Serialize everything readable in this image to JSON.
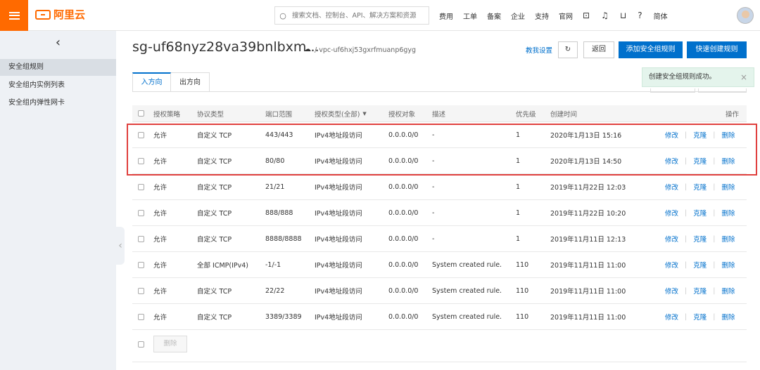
{
  "topbar": {
    "logo_text": "阿里云",
    "search_placeholder": "搜索文档、控制台、API、解决方案和资源",
    "nav": [
      "费用",
      "工单",
      "备案",
      "企业",
      "支持",
      "官网"
    ],
    "lang": "简体"
  },
  "sidebar": {
    "back_glyph": "‹",
    "items": [
      "安全组规则",
      "安全组内实例列表",
      "安全组内弹性网卡"
    ]
  },
  "header": {
    "title": "sg-uf68nyz28va39bnlbxm...",
    "vpc": "/ vpc-uf6hxj53gxrfmuanp6gyg",
    "teach": "教我设置",
    "back_btn": "返回",
    "add_btn": "添加安全组规则",
    "quick_btn": "快速创建规则"
  },
  "tabs": [
    "入方向",
    "出方向"
  ],
  "toast": {
    "text": "创建安全组规则成功。",
    "close": "×"
  },
  "table": {
    "headers": [
      "授权策略",
      "协议类型",
      "端口范围",
      "授权类型(全部)",
      "授权对象",
      "描述",
      "优先级",
      "创建时间",
      "操作"
    ],
    "actions": [
      "修改",
      "克隆",
      "删除"
    ],
    "rows": [
      [
        "允许",
        "自定义 TCP",
        "443/443",
        "IPv4地址段访问",
        "0.0.0.0/0",
        "-",
        "1",
        "2020年1月13日 15:16"
      ],
      [
        "允许",
        "自定义 TCP",
        "80/80",
        "IPv4地址段访问",
        "0.0.0.0/0",
        "-",
        "1",
        "2020年1月13日 14:50"
      ],
      [
        "允许",
        "自定义 TCP",
        "21/21",
        "IPv4地址段访问",
        "0.0.0.0/0",
        "-",
        "1",
        "2019年11月22日 12:03"
      ],
      [
        "允许",
        "自定义 TCP",
        "888/888",
        "IPv4地址段访问",
        "0.0.0.0/0",
        "-",
        "1",
        "2019年11月22日 10:20"
      ],
      [
        "允许",
        "自定义 TCP",
        "8888/8888",
        "IPv4地址段访问",
        "0.0.0.0/0",
        "-",
        "1",
        "2019年11月11日 12:13"
      ],
      [
        "允许",
        "全部 ICMP(IPv4)",
        "-1/-1",
        "IPv4地址段访问",
        "0.0.0.0/0",
        "System created rule.",
        "110",
        "2019年11月11日 11:00"
      ],
      [
        "允许",
        "自定义 TCP",
        "22/22",
        "IPv4地址段访问",
        "0.0.0.0/0",
        "System created rule.",
        "110",
        "2019年11月11日 11:00"
      ],
      [
        "允许",
        "自定义 TCP",
        "3389/3389",
        "IPv4地址段访问",
        "0.0.0.0/0",
        "System created rule.",
        "110",
        "2019年11月11日 11:00"
      ]
    ],
    "bulk_delete": "删除"
  },
  "colors": {
    "accent": "#0070cc",
    "brand": "#ff6a00",
    "highlight": "#e0403e"
  }
}
